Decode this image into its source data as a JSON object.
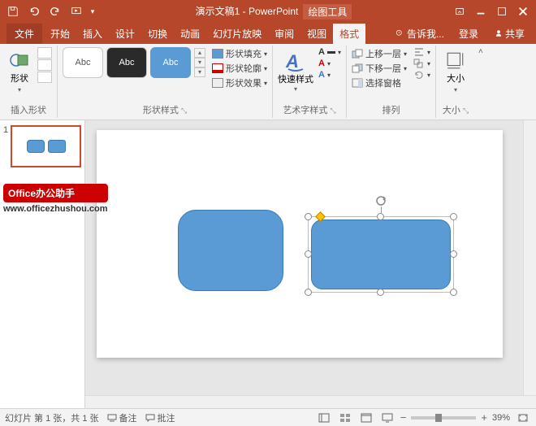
{
  "titlebar": {
    "doc_title": "演示文稿1 - PowerPoint",
    "context_tab": "绘图工具"
  },
  "menu": {
    "file": "文件",
    "home": "开始",
    "insert": "插入",
    "design": "设计",
    "transitions": "切换",
    "animations": "动画",
    "slideshow": "幻灯片放映",
    "review": "审阅",
    "view": "视图",
    "format": "格式",
    "tell_me": "告诉我...",
    "login": "登录",
    "share": "共享"
  },
  "ribbon": {
    "insert_shapes": {
      "shapes": "形状",
      "label": "插入形状"
    },
    "shape_styles": {
      "sample": "Abc",
      "fill": "形状填充",
      "outline": "形状轮廓",
      "effects": "形状效果",
      "label": "形状样式"
    },
    "wordart": {
      "quick": "快速样式",
      "label": "艺术字样式"
    },
    "arrange": {
      "bring_forward": "上移一层",
      "send_backward": "下移一层",
      "selection_pane": "选择窗格",
      "label": "排列"
    },
    "size": {
      "label": "大小"
    }
  },
  "thumbs": {
    "slide1_num": "1"
  },
  "badge": {
    "title": "Office办公助手",
    "url": "www.officezhushou.com"
  },
  "status": {
    "slide_info": "幻灯片 第 1 张，共 1 张",
    "notes": "备注",
    "comments": "批注",
    "zoom": "39%"
  }
}
